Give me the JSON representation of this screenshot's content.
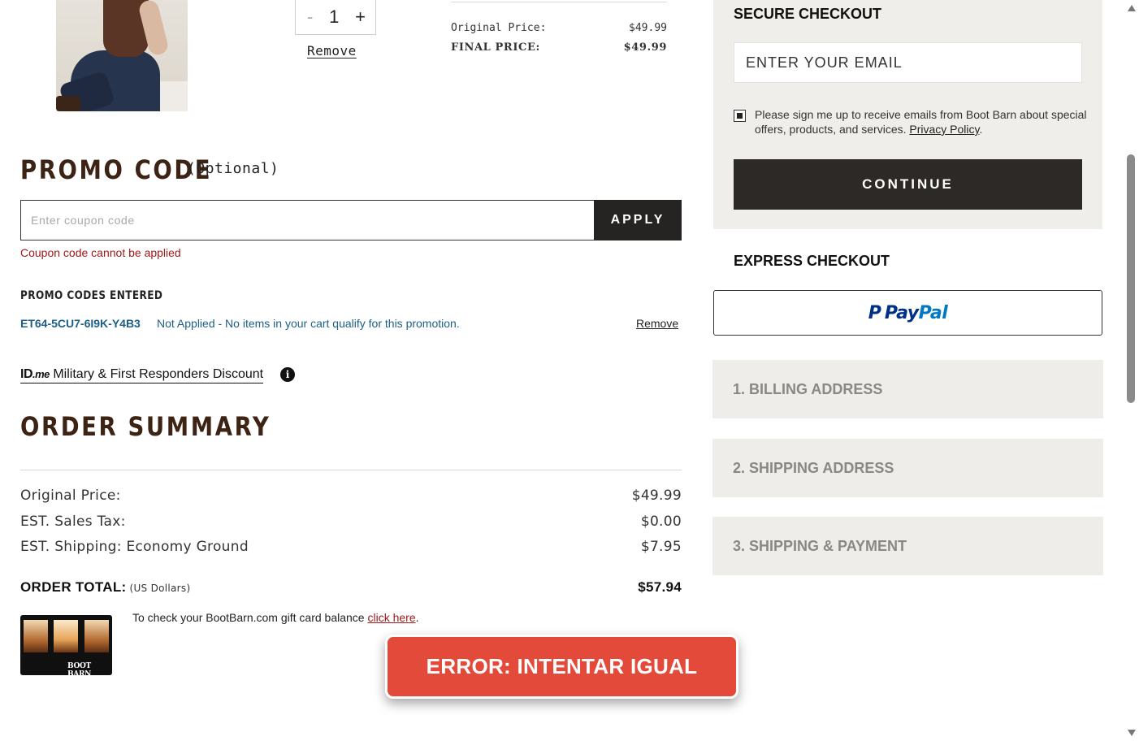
{
  "cart_item": {
    "image_alt": "Woman in brown vest and dark jeans",
    "qty_minus": "-",
    "qty_value": "1",
    "qty_plus": "+",
    "remove_label": "Remove",
    "original_price_label": "Original Price:",
    "original_price_value": "$49.99",
    "final_price_label": "FINAL PRICE:",
    "final_price_value": "$49.99"
  },
  "promo": {
    "title": "PROMO CODE",
    "optional": "(Optional)",
    "placeholder": "Enter coupon code",
    "apply_label": "APPLY",
    "error": "Coupon code cannot be applied",
    "entered_title": "PROMO CODES ENTERED",
    "code": "ET64-5CU7-6I9K-Y4B3",
    "status": "Not Applied - No items in your cart qualify for this promotion.",
    "remove_label": "Remove"
  },
  "idme": {
    "logo_id": "ID",
    "logo_me": ".me",
    "link_text": " Military & First Responders Discount",
    "info_glyph": "i"
  },
  "order_summary": {
    "title": "ORDER SUMMARY",
    "rows": [
      {
        "label": "Original Price:",
        "value": "$49.99"
      },
      {
        "label": "EST. Sales Tax:",
        "value": "$0.00"
      },
      {
        "label": "EST. Shipping: Economy Ground",
        "value": "$7.95"
      }
    ],
    "total_label": "ORDER TOTAL:",
    "total_sub": "(US Dollars)",
    "total_value": "$57.94"
  },
  "gift_card": {
    "brand": "BOOT BARN",
    "text_before": "To check your BootBarn.com gift card balance ",
    "link": "click here",
    "text_after": "."
  },
  "secure_checkout": {
    "title": "SECURE CHECKOUT",
    "email_placeholder": "ENTER YOUR EMAIL",
    "optin_text": "Please sign me up to receive emails from Boot Barn about special offers, products, and services. ",
    "privacy_link": "Privacy Policy",
    "optin_after": ".",
    "continue_label": "CONTINUE"
  },
  "express_checkout": {
    "title": "EXPRESS CHECKOUT",
    "paypal_pay": "Pay",
    "paypal_pal": "Pal",
    "paypal_p": "P"
  },
  "steps": [
    {
      "label": "1. BILLING ADDRESS"
    },
    {
      "label": "2. SHIPPING ADDRESS"
    },
    {
      "label": "3. SHIPPING & PAYMENT"
    }
  ],
  "overlay": {
    "error_text": "ERROR: INTENTAR IGUAL"
  },
  "colors": {
    "brand_brown": "#3c2314",
    "error_red": "#a0191b",
    "link_blue": "#1d5f86",
    "banner_red": "#e44a3a",
    "button_dark": "#2c2927",
    "panel_bg": "#f0eeeb"
  }
}
